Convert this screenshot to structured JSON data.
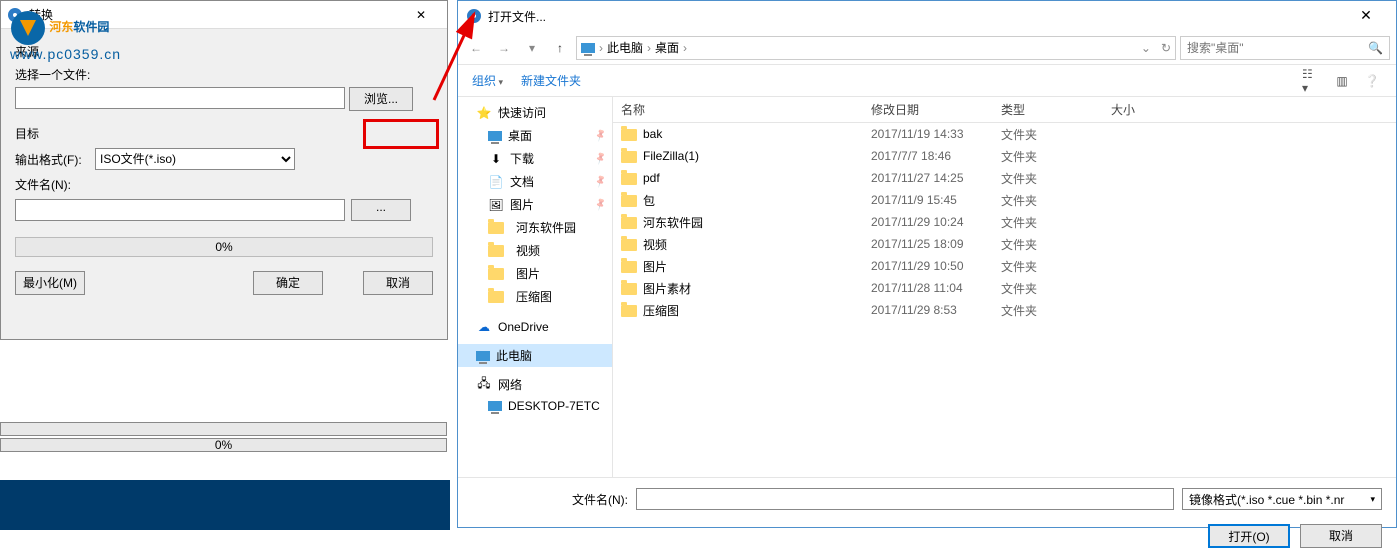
{
  "watermark": {
    "brand_a": "河东",
    "brand_b": "软件园",
    "url": "www.pc0359.cn"
  },
  "left_dialog": {
    "title": "转换",
    "source_label": "来源",
    "select_file_label": "选择一个文件:",
    "browse": "浏览...",
    "target_label": "目标",
    "output_format_label": "输出格式(F):",
    "output_format_value": "ISO文件(*.iso)",
    "filename_label": "文件名(N):",
    "ellipsis": "...",
    "progress": "0%",
    "minimize": "最小化(M)",
    "ok": "确定",
    "cancel": "取消"
  },
  "bottom_progress": "0%",
  "file_dialog": {
    "title": "打开文件...",
    "breadcrumb": [
      "此电脑",
      "桌面"
    ],
    "search_placeholder": "搜索\"桌面\"",
    "toolbar": {
      "organize": "组织",
      "new_folder": "新建文件夹"
    },
    "sidebar": {
      "quick_access": "快速访问",
      "items_pinned": [
        "桌面",
        "下载",
        "文档",
        "图片"
      ],
      "items_recent": [
        "河东软件园",
        "视频",
        "图片",
        "压缩图"
      ],
      "onedrive": "OneDrive",
      "this_pc": "此电脑",
      "network": "网络",
      "network_item": "DESKTOP-7ETC"
    },
    "columns": {
      "name": "名称",
      "date": "修改日期",
      "type": "类型",
      "size": "大小"
    },
    "rows": [
      {
        "name": "bak",
        "date": "2017/11/19 14:33",
        "type": "文件夹"
      },
      {
        "name": "FileZilla(1)",
        "date": "2017/7/7 18:46",
        "type": "文件夹"
      },
      {
        "name": "pdf",
        "date": "2017/11/27 14:25",
        "type": "文件夹"
      },
      {
        "name": "包",
        "date": "2017/11/9 15:45",
        "type": "文件夹"
      },
      {
        "name": "河东软件园",
        "date": "2017/11/29 10:24",
        "type": "文件夹"
      },
      {
        "name": "视频",
        "date": "2017/11/25 18:09",
        "type": "文件夹"
      },
      {
        "name": "图片",
        "date": "2017/11/29 10:50",
        "type": "文件夹"
      },
      {
        "name": "图片素材",
        "date": "2017/11/28 11:04",
        "type": "文件夹"
      },
      {
        "name": "压缩图",
        "date": "2017/11/29 8:53",
        "type": "文件夹"
      }
    ],
    "footer": {
      "filename_label": "文件名(N):",
      "filter": "镜像格式(*.iso *.cue *.bin *.nr",
      "open": "打开(O)",
      "cancel": "取消"
    }
  }
}
